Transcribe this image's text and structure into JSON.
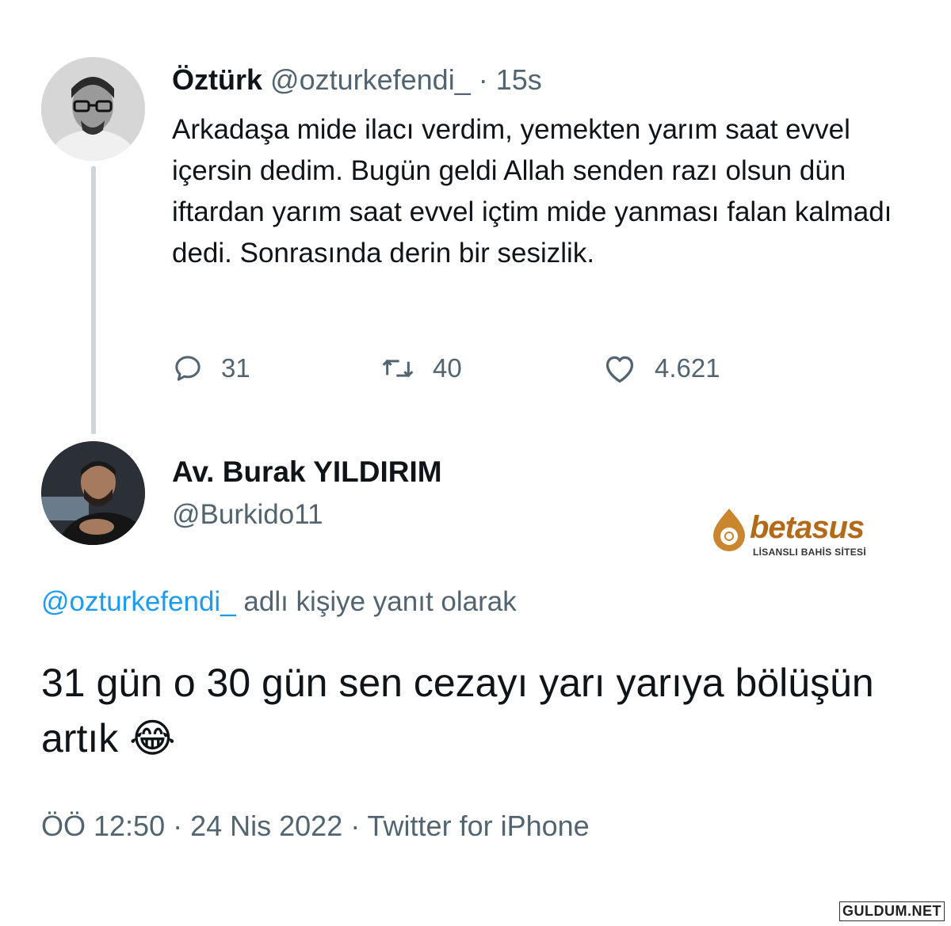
{
  "tweet1": {
    "name": "Öztürk",
    "handle": "@ozturkefendi_",
    "dot": "·",
    "time": "15s",
    "text": "Arkadaşa mide ilacı verdim, yemekten yarım saat evvel içersin dedim. Bugün geldi Allah senden razı olsun dün iftardan yarım saat evvel içtim mide yanması falan kalmadı dedi. Sonrasında derin bir sesizlik.",
    "replies": "31",
    "retweets": "40",
    "likes": "4.621"
  },
  "tweet2": {
    "name": "Av. Burak YILDIRIM",
    "handle": "@Burkido11",
    "reply_mention": "@ozturkefendi_",
    "reply_suffix": "adlı kişiye yanıt olarak",
    "text": "31 gün o 30 gün sen cezayı yarı yarıya bölüşün artık 😂",
    "meta": "ÖÖ 12:50 · 24 Nis 2022 · Twitter for iPhone"
  },
  "ad": {
    "brand": "betasus",
    "tagline": "LİSANSLI BAHİS SİTESİ",
    "accent_color": "#b36a18"
  },
  "watermark": "GULDUM.NET",
  "colors": {
    "text": "#0f1419",
    "secondary": "#536471",
    "link": "#1d9bf0",
    "thread_line": "#d0d5da"
  }
}
